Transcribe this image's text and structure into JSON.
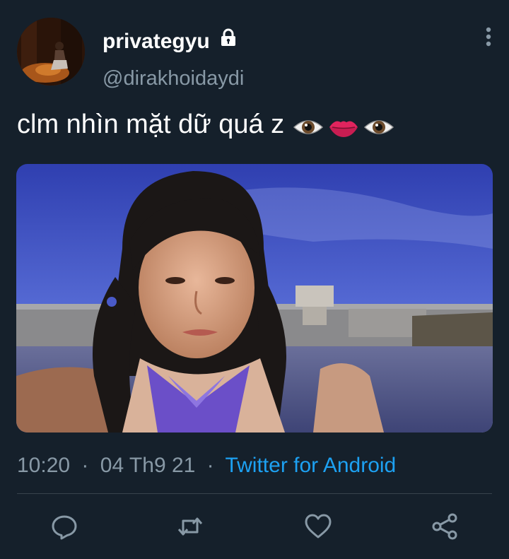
{
  "user": {
    "display_name": "privategyu",
    "handle": "@dirakhoidaydi",
    "protected_icon": "lock-icon",
    "avatar_icon": "avatar-photo"
  },
  "tweet": {
    "text": "clm nhìn mặt dữ quá z",
    "emojis": [
      "eye-emoji",
      "lips-emoji",
      "eye-emoji"
    ],
    "media_icon": "photo-girl-by-sea"
  },
  "meta": {
    "time": "10:20",
    "separator": "·",
    "date": "04 Th9 21",
    "source": "Twitter for Android"
  },
  "actions": {
    "icons": [
      "reply-icon",
      "retweet-icon",
      "like-icon",
      "share-icon"
    ]
  },
  "colors": {
    "background": "#15202b",
    "secondary_text": "#8899a6",
    "link": "#1da1f2",
    "divider": "#38444d"
  }
}
